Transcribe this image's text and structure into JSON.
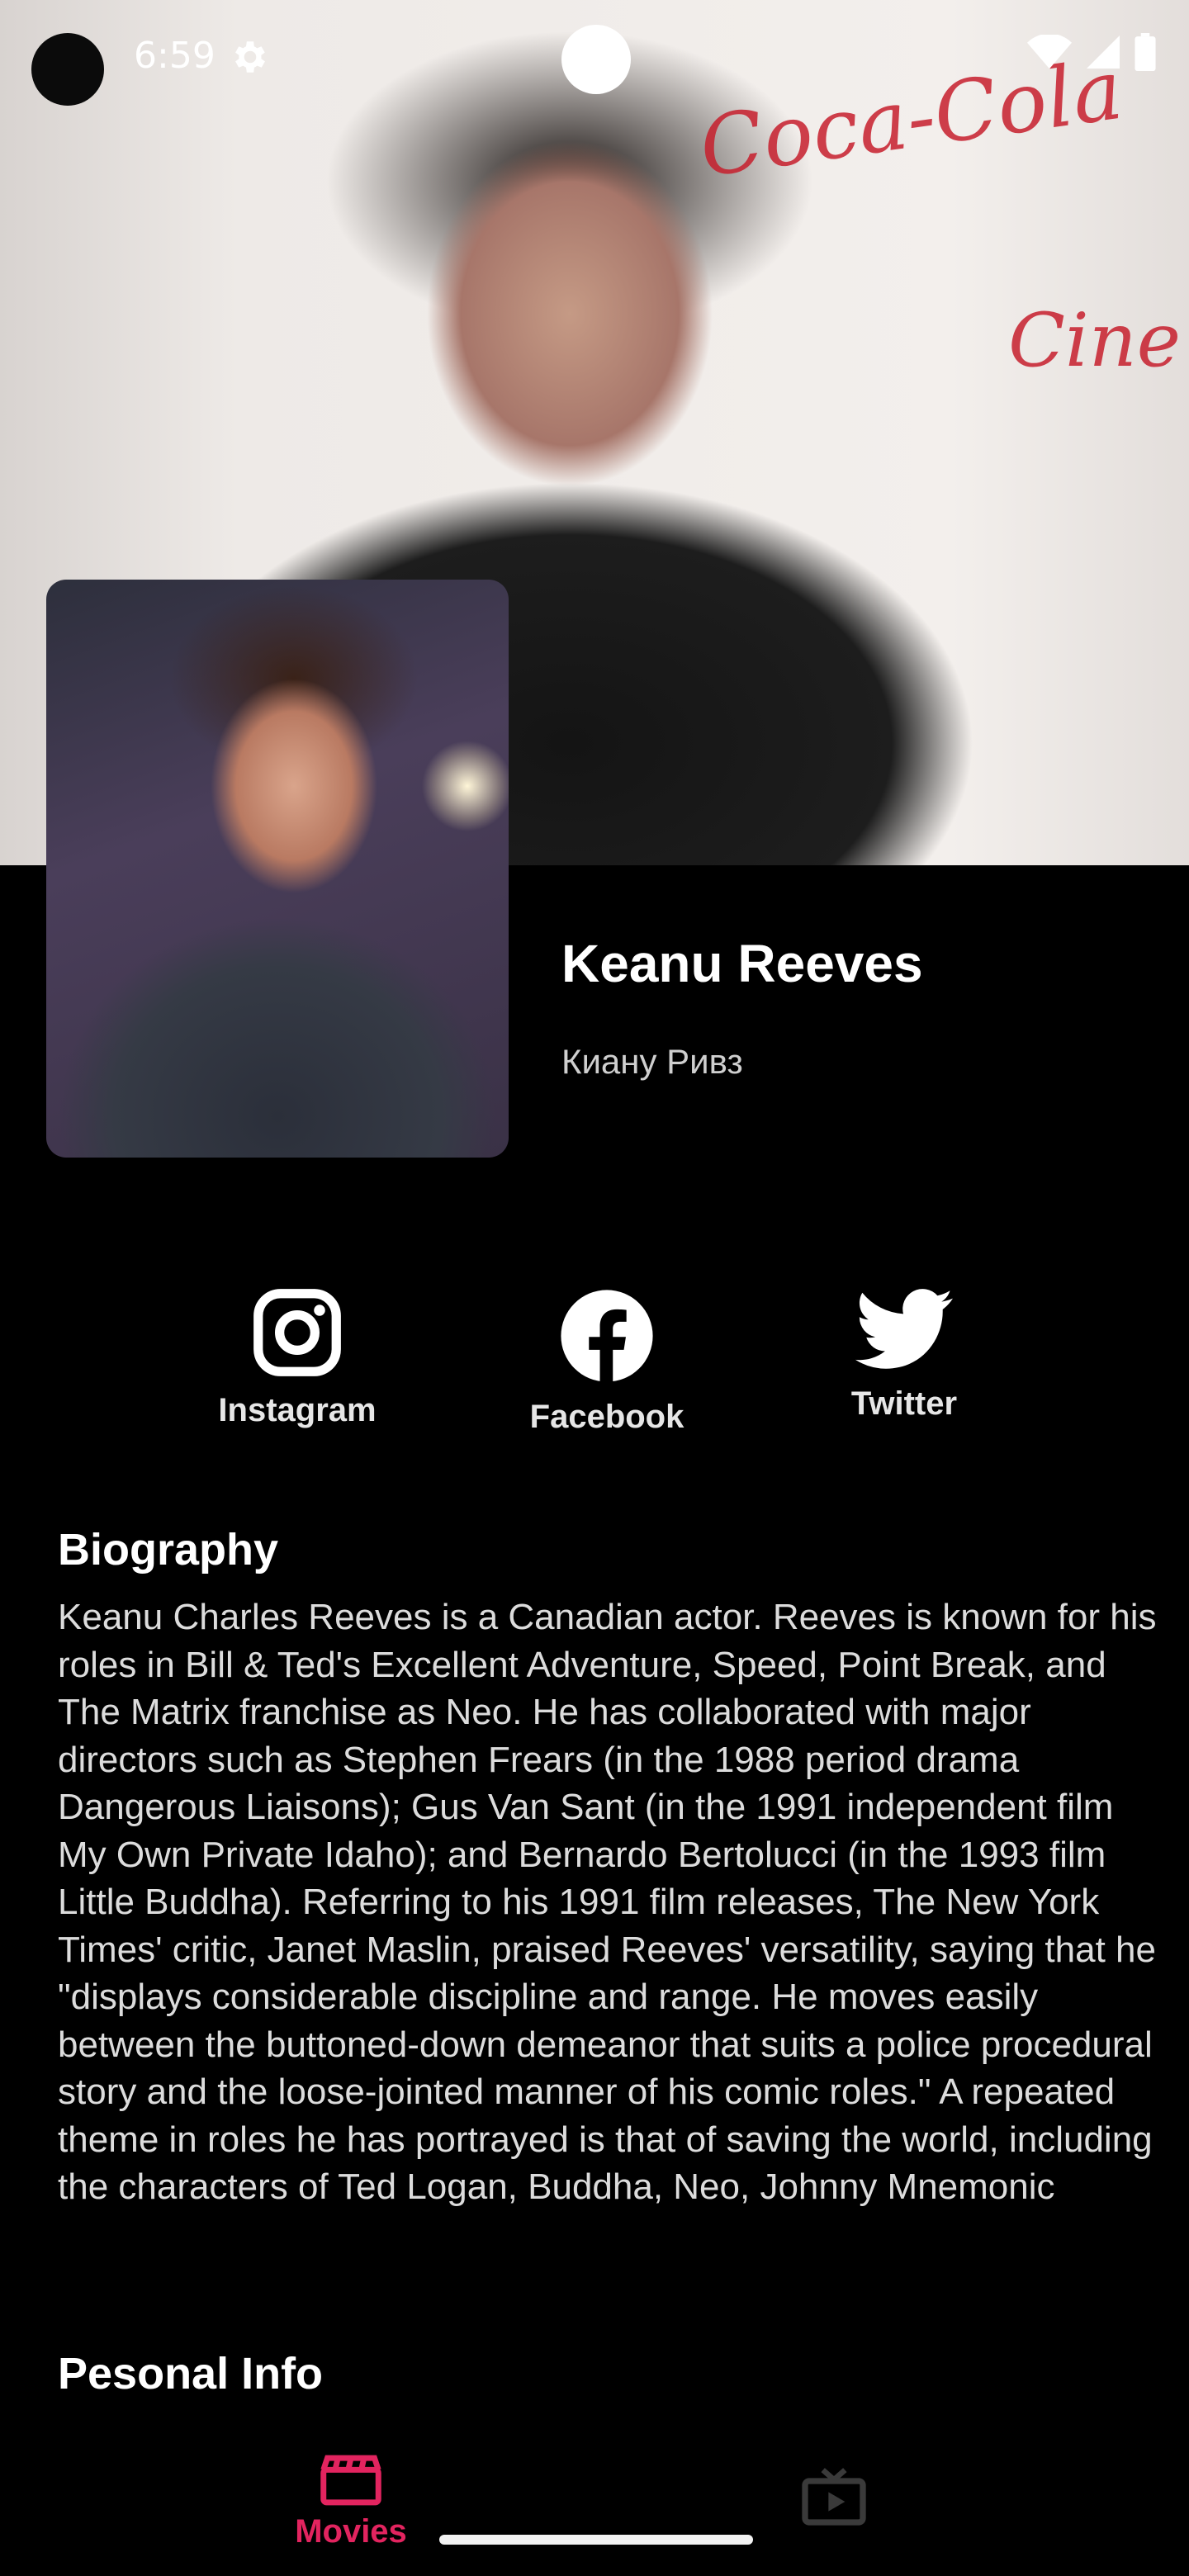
{
  "status_bar": {
    "time": "6:59",
    "icons": [
      "settings-icon",
      "wifi-icon",
      "cellular-icon",
      "battery-icon"
    ]
  },
  "backdrop": {
    "wall_text": [
      "Coca-Cola",
      "Cine"
    ]
  },
  "person": {
    "name": "Keanu Reeves",
    "native_name": "Киану Ривз"
  },
  "socials": [
    {
      "label": "Instagram",
      "icon": "instagram-icon"
    },
    {
      "label": "Facebook",
      "icon": "facebook-icon"
    },
    {
      "label": "Twitter",
      "icon": "twitter-icon"
    }
  ],
  "biography": {
    "title": "Biography",
    "text": "Keanu Charles Reeves is a Canadian actor. Reeves is known for his roles in Bill & Ted's Excellent Adventure, Speed, Point Break, and The Matrix franchise as Neo. He has collaborated with major directors such as Stephen Frears (in the 1988 period drama Dangerous Liaisons); Gus Van Sant (in the 1991 independent film My Own Private Idaho); and Bernardo Bertolucci (in the 1993 film Little Buddha). Referring to his 1991 film releases, The New York Times' critic, Janet Maslin, praised Reeves' versatility, saying that he \"displays considerable discipline and range. He moves easily between the buttoned-down demeanor that suits a police procedural story and the loose-jointed manner of his comic roles.\" A repeated theme in roles he has portrayed is that of saving the world, including the characters of Ted Logan, Buddha, Neo, Johnny Mnemonic"
  },
  "personal_info": {
    "title": "Pesonal Info"
  },
  "bottom_nav": {
    "items": [
      {
        "label": "Movies",
        "icon": "clapperboard-icon",
        "active": true
      },
      {
        "label": "",
        "icon": "tv-icon",
        "active": false
      }
    ]
  },
  "colors": {
    "accent": "#e2245f",
    "background": "#000000",
    "text": "#ffffff",
    "muted": "#dcdcdc",
    "inactive_icon": "#3a3a3a"
  }
}
